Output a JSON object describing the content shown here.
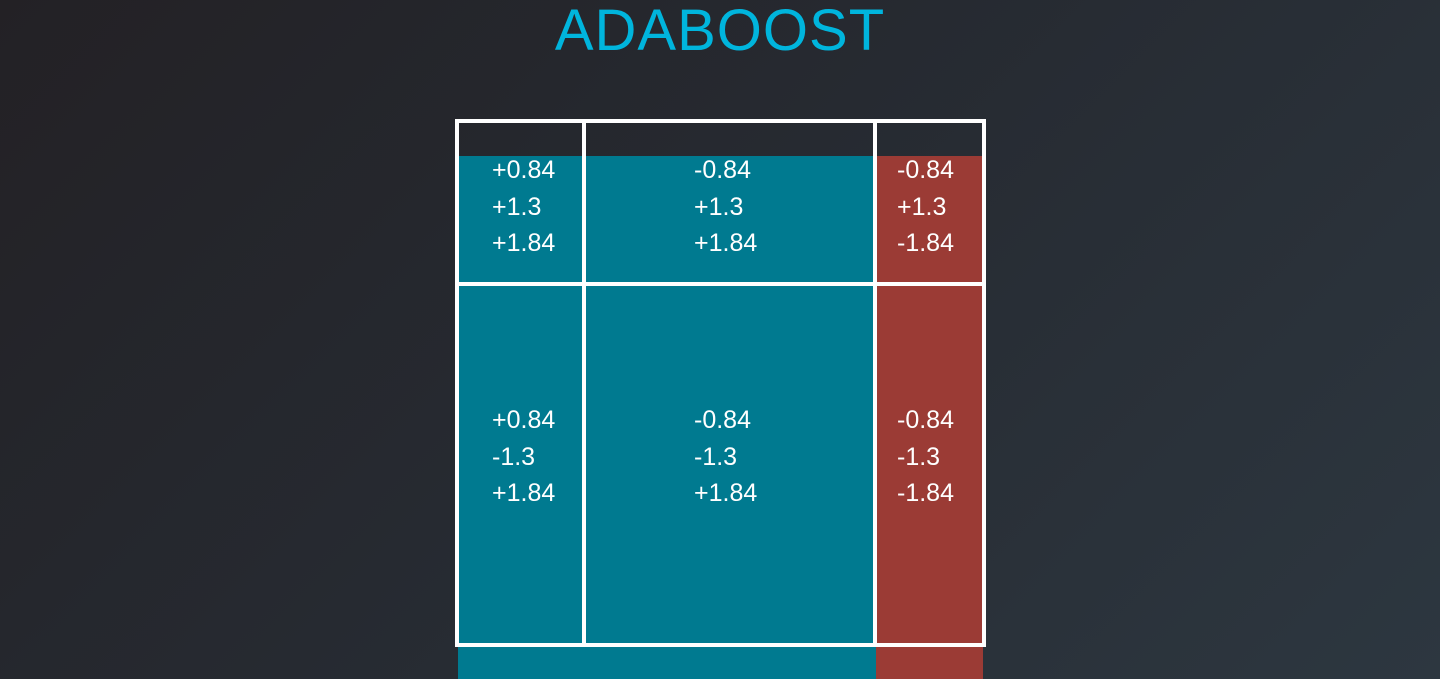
{
  "title": "ADABOOST",
  "colors": {
    "title": "#00b5dd",
    "positive_region": "#007a90",
    "negative_region": "#9b3b35",
    "grid_lines": "#ffffff"
  },
  "cells": {
    "top_left": [
      "+0.84",
      "+1.3",
      "+1.84"
    ],
    "top_middle": [
      "-0.84",
      "+1.3",
      "+1.84"
    ],
    "top_right": [
      "-0.84",
      "+1.3",
      "-1.84"
    ],
    "bottom_left": [
      "+0.84",
      "-1.3",
      "+1.84"
    ],
    "bottom_middle": [
      "-0.84",
      "-1.3",
      "+1.84"
    ],
    "bottom_right": [
      "-0.84",
      "-1.3",
      "-1.84"
    ]
  }
}
